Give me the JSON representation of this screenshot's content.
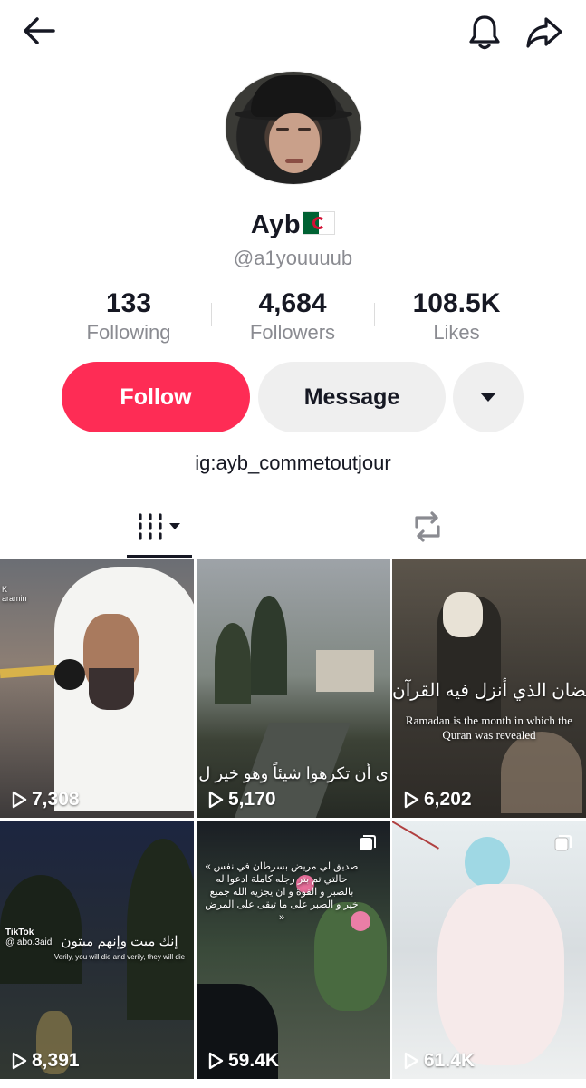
{
  "header": {
    "back_icon": "arrow-left-icon",
    "bell_icon": "bell-icon",
    "share_icon": "share-icon"
  },
  "profile": {
    "name": "Ayb",
    "flag": "algeria-flag",
    "handle": "@a1youuuub",
    "bio": "ig:ayb_commetoutjour"
  },
  "stats": [
    {
      "value": "133",
      "label": "Following"
    },
    {
      "value": "4,684",
      "label": "Followers"
    },
    {
      "value": "108.5K",
      "label": "Likes"
    }
  ],
  "actions": {
    "follow_label": "Follow",
    "message_label": "Message",
    "more_icon": "caret-down-icon"
  },
  "colors": {
    "accent": "#fe2c55",
    "secondary_button": "#efefef",
    "muted_text": "#8a8b91"
  },
  "tabs": [
    {
      "name": "videos",
      "icon": "grid-videos-icon",
      "active": true
    },
    {
      "name": "reposts",
      "icon": "repost-icon",
      "active": false
    }
  ],
  "videos": [
    {
      "views": "7,308",
      "caption": "",
      "corner_label": "K\naramin"
    },
    {
      "views": "5,170",
      "caption": "ى أن تكرهوا شيئاً وهو خير ل",
      "corner_label": ""
    },
    {
      "views": "6,202",
      "caption": "Ramadan is the month in which the Quran was revealed",
      "arabic": "رمضان الذي أنزل فيه القرآن",
      "corner_label": ""
    },
    {
      "views": "8,391",
      "caption": "Verily, you will die and verily, they will die",
      "arabic": "إنك ميت وإنهم ميتون",
      "watermark": "TikTok",
      "watermark_handle": "@ abo.3aid",
      "corner_label": ""
    },
    {
      "views": "59.4K",
      "caption": "« صديق لي مريض بسرطان في نفس حالتي تم بتر رجله كاملة ادعوا له بالصبر و القوة و ان يجزيه الله جميع خير و الصبر على ما تبقى على المرض »",
      "multi": true,
      "corner_label": ""
    },
    {
      "views": "61.4K",
      "caption": "",
      "multi": true,
      "corner_label": ""
    }
  ]
}
